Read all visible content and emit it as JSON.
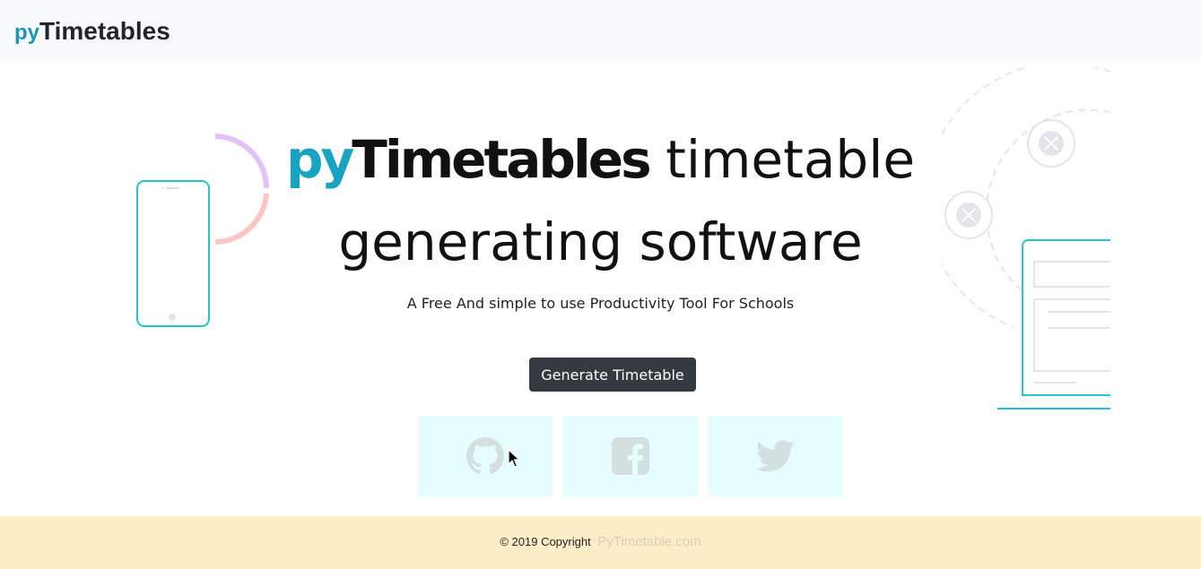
{
  "navbar": {
    "brand_prefix": "py",
    "brand_name": "Timetables"
  },
  "hero": {
    "title_prefix": "py",
    "title_brand": "Timetables",
    "title_line1_rest": " timetable",
    "title_line2": "generating software",
    "subtitle": "A Free And simple to use Productivity Tool For Schools",
    "cta_label": "Generate Timetable"
  },
  "social": [
    {
      "name": "github",
      "icon": "github-icon"
    },
    {
      "name": "facebook",
      "icon": "facebook-icon"
    },
    {
      "name": "twitter",
      "icon": "twitter-icon"
    }
  ],
  "footer": {
    "copyright": "© 2019 Copyright",
    "link_text": "PyTimetable.com"
  },
  "colors": {
    "accent": "#1aa3c1",
    "navbar_bg": "#f8f9fa",
    "button_bg": "#343a40",
    "social_bg": "#e6fdfe",
    "footer_bg": "#fdedc6",
    "icon_color": "#d4e0e0"
  }
}
